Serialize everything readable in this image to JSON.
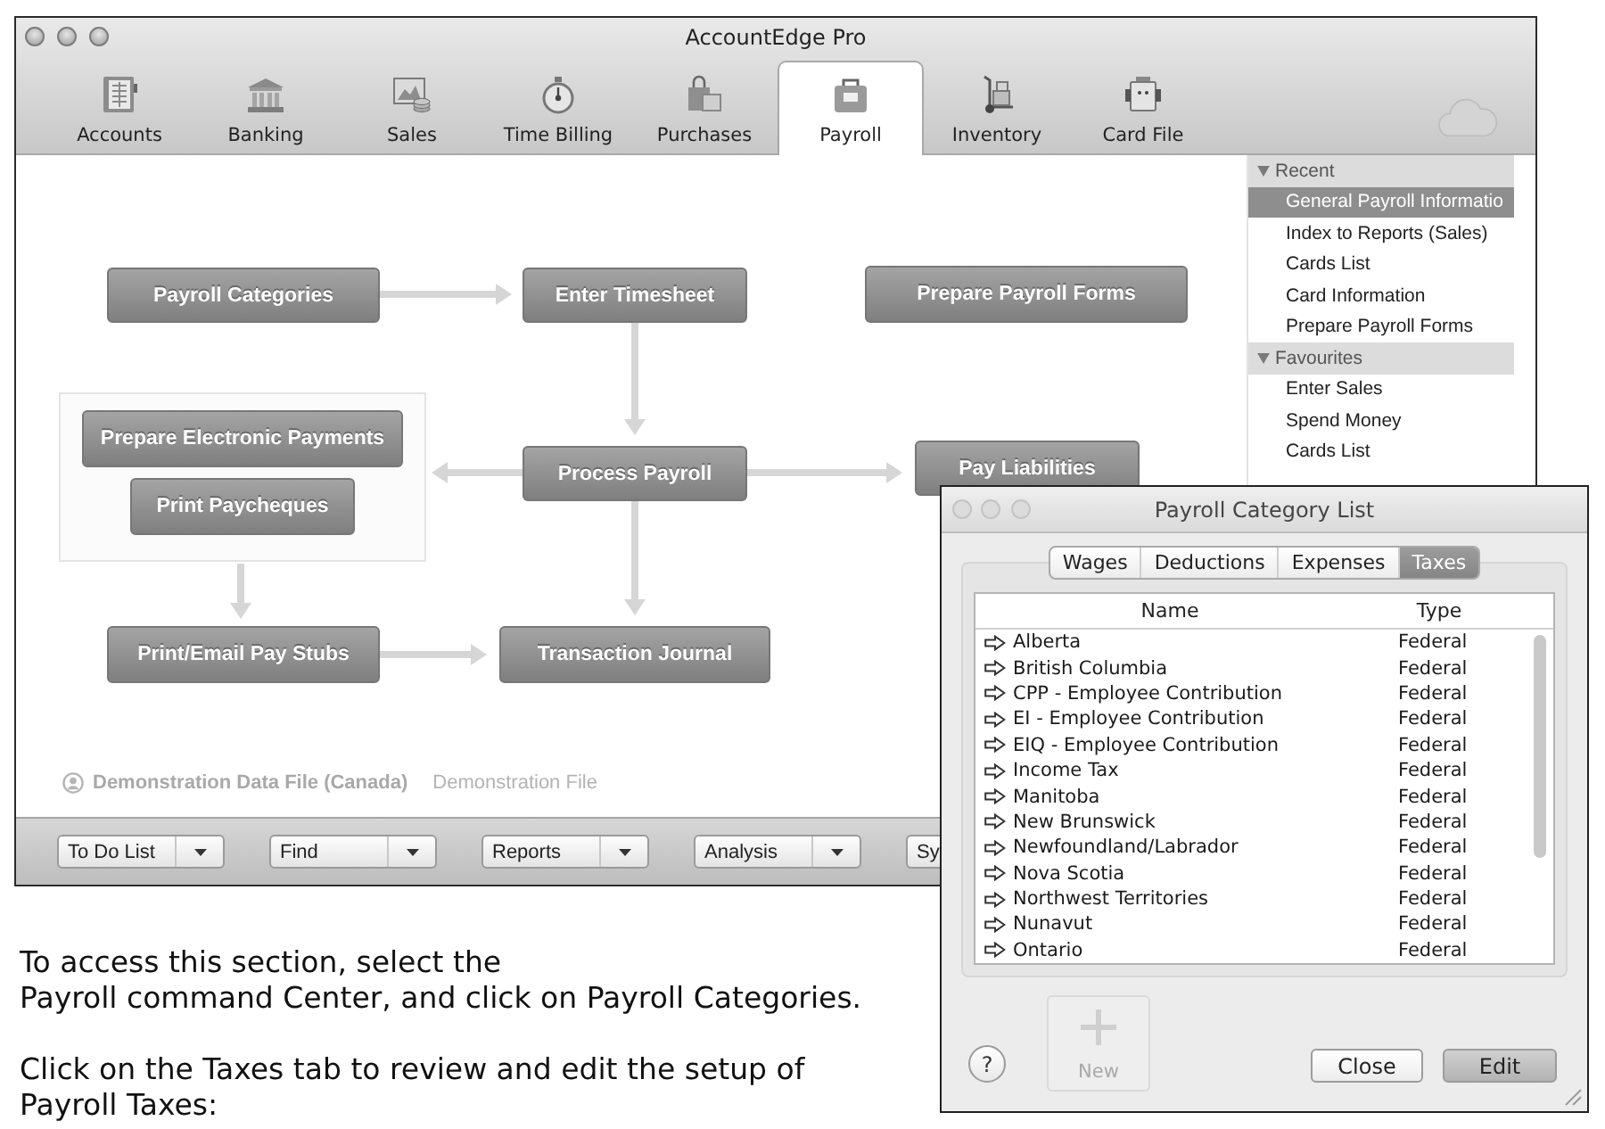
{
  "main_window": {
    "title": "AccountEdge Pro",
    "toolbar_tabs": [
      {
        "label": "Accounts",
        "selected": false
      },
      {
        "label": "Banking",
        "selected": false
      },
      {
        "label": "Sales",
        "selected": false
      },
      {
        "label": "Time Billing",
        "selected": false
      },
      {
        "label": "Purchases",
        "selected": false
      },
      {
        "label": "Payroll",
        "selected": true
      },
      {
        "label": "Inventory",
        "selected": false
      },
      {
        "label": "Card File",
        "selected": false
      }
    ],
    "flowchart_nodes": [
      "Payroll Categories",
      "Enter Timesheet",
      "Prepare Payroll Forms",
      "Prepare Electronic Payments",
      "Print Paycheques",
      "Process Payroll",
      "Pay Liabilities",
      "Print/Email Pay Stubs",
      "Transaction Journal"
    ],
    "data_file": {
      "name": "Demonstration Data File (Canada)",
      "note": "Demonstration File"
    },
    "sidebar": [
      {
        "title": "Recent",
        "expanded": true,
        "items": [
          {
            "label": "General Payroll Informatio",
            "selected": true
          },
          {
            "label": "Index to Reports (Sales)",
            "selected": false
          },
          {
            "label": "Cards List",
            "selected": false
          },
          {
            "label": "Card Information",
            "selected": false
          },
          {
            "label": "Prepare Payroll Forms",
            "selected": false
          }
        ]
      },
      {
        "title": "Favourites",
        "expanded": true,
        "items": [
          {
            "label": "Enter Sales",
            "selected": false
          },
          {
            "label": "Spend Money",
            "selected": false
          },
          {
            "label": "Cards List",
            "selected": false
          }
        ]
      }
    ],
    "bottom_bar": [
      "To Do List",
      "Find",
      "Reports",
      "Analysis",
      "Sy"
    ]
  },
  "dialog": {
    "title": "Payroll Category List",
    "tabs": [
      {
        "label": "Wages",
        "selected": false
      },
      {
        "label": "Deductions",
        "selected": false
      },
      {
        "label": "Expenses",
        "selected": false
      },
      {
        "label": "Taxes",
        "selected": true
      }
    ],
    "table": {
      "columns": [
        "Name",
        "Type"
      ],
      "rows": [
        {
          "name": "Alberta",
          "type": "Federal"
        },
        {
          "name": "British Columbia",
          "type": "Federal"
        },
        {
          "name": "CPP - Employee Contribution",
          "type": "Federal"
        },
        {
          "name": "EI - Employee Contribution",
          "type": "Federal"
        },
        {
          "name": "EIQ - Employee Contribution",
          "type": "Federal"
        },
        {
          "name": "Income Tax",
          "type": "Federal"
        },
        {
          "name": "Manitoba",
          "type": "Federal"
        },
        {
          "name": "New Brunswick",
          "type": "Federal"
        },
        {
          "name": "Newfoundland/Labrador",
          "type": "Federal"
        },
        {
          "name": "Nova Scotia",
          "type": "Federal"
        },
        {
          "name": "Northwest Territories",
          "type": "Federal"
        },
        {
          "name": "Nunavut",
          "type": "Federal"
        },
        {
          "name": "Ontario",
          "type": "Federal"
        }
      ]
    },
    "help_button": "?",
    "new_button": {
      "label": "New",
      "disabled": true
    },
    "buttons": [
      {
        "label": "Close",
        "default": false
      },
      {
        "label": "Edit",
        "default": true
      }
    ]
  },
  "instructions": [
    "To access this section, select the\nPayroll command Center, and click on Payroll Categories.",
    "Click on the Taxes tab to review and edit the setup of\nPayroll Taxes:"
  ]
}
